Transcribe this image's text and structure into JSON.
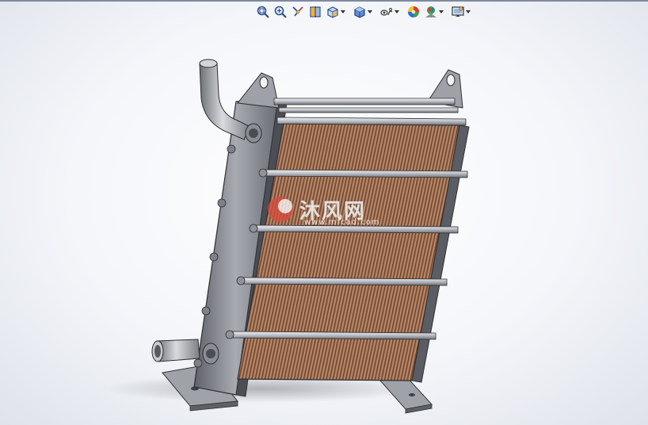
{
  "toolbar": {
    "tools": [
      {
        "name": "zoom-to-fit",
        "icon": "zoom-fit-icon",
        "has_menu": false
      },
      {
        "name": "zoom-to-area",
        "icon": "zoom-area-icon",
        "has_menu": false
      },
      {
        "name": "previous-view",
        "icon": "previous-view-icon",
        "has_menu": false
      },
      {
        "name": "section-view",
        "icon": "section-view-icon",
        "has_menu": false
      },
      {
        "name": "view-orientation",
        "icon": "view-orientation-icon",
        "has_menu": true
      },
      {
        "name": "display-style",
        "icon": "display-style-icon",
        "has_menu": true
      },
      {
        "name": "hide-show-items",
        "icon": "hide-show-icon",
        "has_menu": true
      },
      {
        "name": "edit-appearance",
        "icon": "appearance-icon",
        "has_menu": false
      },
      {
        "name": "apply-scene",
        "icon": "scene-icon",
        "has_menu": true
      },
      {
        "name": "view-settings",
        "icon": "view-settings-icon",
        "has_menu": true
      }
    ]
  },
  "watermark": {
    "text": "沐风网",
    "url": "www.mfcad.com"
  },
  "colors": {
    "fin": "#9c6a4c",
    "steel": "#8a8d93",
    "rod": "#d7dadf",
    "background": "#f4f6fa"
  }
}
